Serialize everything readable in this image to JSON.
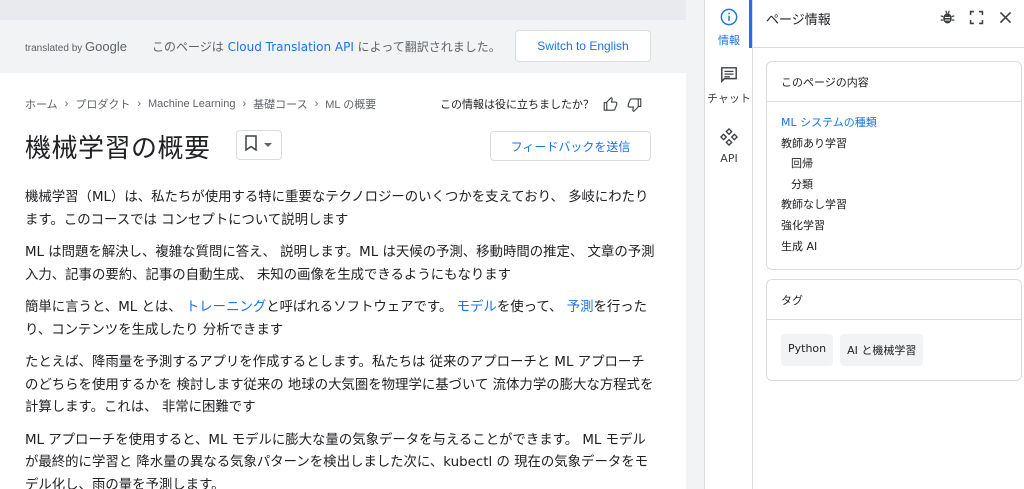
{
  "translation_bar": {
    "translated_by": "translated by",
    "google": "Google",
    "message_prefix": "このページは ",
    "message_link": "Cloud Translation API",
    "message_suffix": " によって翻訳されました。",
    "switch_button": "Switch to English"
  },
  "breadcrumb": [
    "ホーム",
    "プロダクト",
    "Machine Learning",
    "基礎コース",
    "ML の概要"
  ],
  "helpful_question": "この情報は役に立ちましたか？",
  "page_title": "機械学習の概要",
  "feedback_button": "フィードバックを送信",
  "article": {
    "p1": "機械学習（ML）は、私たちが使用する特に重要なテクノロジーのいくつかを支えており、 多岐にわたります。このコースでは コンセプトについて説明します",
    "p2": "ML は問題を解決し、複雑な質問に答え、 説明します。ML は天候の予測、移動時間の推定、 文章の予測入力、記事の要約、記事の自動生成、 未知の画像を生成できるようにもなります",
    "p3_a": "簡単に言うと、ML とは、 ",
    "p3_link1": "トレーニング",
    "p3_b": "と呼ばれるソフトウェアです。 ",
    "p3_link2": "モデル",
    "p3_c": "を使って、 ",
    "p3_link3": "予測",
    "p3_d": "を行ったり、コンテンツを生成したり 分析できます",
    "p4": "たとえば、降雨量を予測するアプリを作成するとします。私たちは 従来のアプローチと ML アプローチのどちらを使用するかを 検討します従来の 地球の大気圏を物理学に基づいて 流体力学の膨大な方程式を計算します。これは、 非常に困難です",
    "p5": "ML アプローチを使用すると、ML モデルに膨大な量の気象データを与えることができます。 ML モデルが最終的に学習と 降水量の異なる気象パターンを検出しました次に、kubectl の 現在の気象データをモデル化し、雨の量を予測します。"
  },
  "rail": {
    "info": "情報",
    "chat": "チャット",
    "api": "API"
  },
  "panel": {
    "title": "ページ情報",
    "toc_title": "このページの内容",
    "toc": [
      {
        "label": "ML システムの種類",
        "active": true,
        "sub": false
      },
      {
        "label": "教師あり学習",
        "active": false,
        "sub": false
      },
      {
        "label": "回帰",
        "active": false,
        "sub": true
      },
      {
        "label": "分類",
        "active": false,
        "sub": true
      },
      {
        "label": "教師なし学習",
        "active": false,
        "sub": false
      },
      {
        "label": "強化学習",
        "active": false,
        "sub": false
      },
      {
        "label": "生成 AI",
        "active": false,
        "sub": false
      }
    ],
    "tags_title": "タグ",
    "tags": [
      "Python",
      "AI と機械学習"
    ]
  },
  "colors": {
    "accent": "#1a73e8",
    "text": "#202124",
    "muted": "#5f6368",
    "border": "#dadce0"
  }
}
